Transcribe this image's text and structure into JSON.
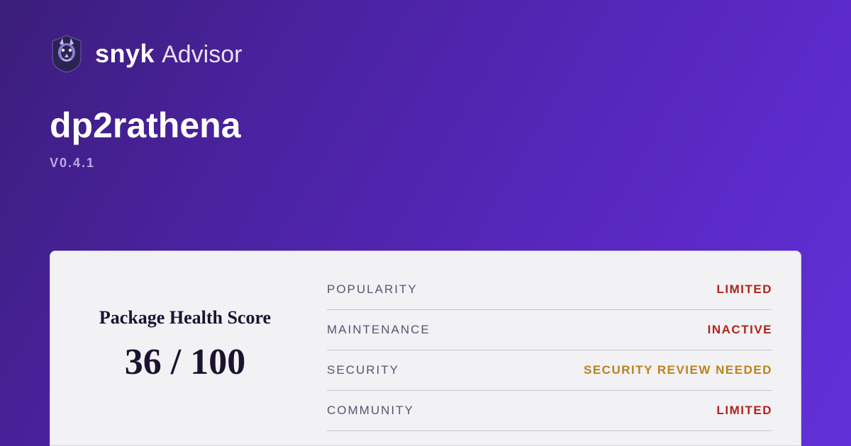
{
  "brand": {
    "name": "snyk",
    "product": "Advisor"
  },
  "package": {
    "name": "dp2rathena",
    "version": "V0.4.1"
  },
  "score": {
    "label": "Package Health Score",
    "value": "36 / 100"
  },
  "metrics": [
    {
      "label": "POPULARITY",
      "value": "LIMITED",
      "tone": "limited"
    },
    {
      "label": "MAINTENANCE",
      "value": "INACTIVE",
      "tone": "inactive"
    },
    {
      "label": "SECURITY",
      "value": "SECURITY REVIEW NEEDED",
      "tone": "warn"
    },
    {
      "label": "COMMUNITY",
      "value": "LIMITED",
      "tone": "limited"
    }
  ]
}
